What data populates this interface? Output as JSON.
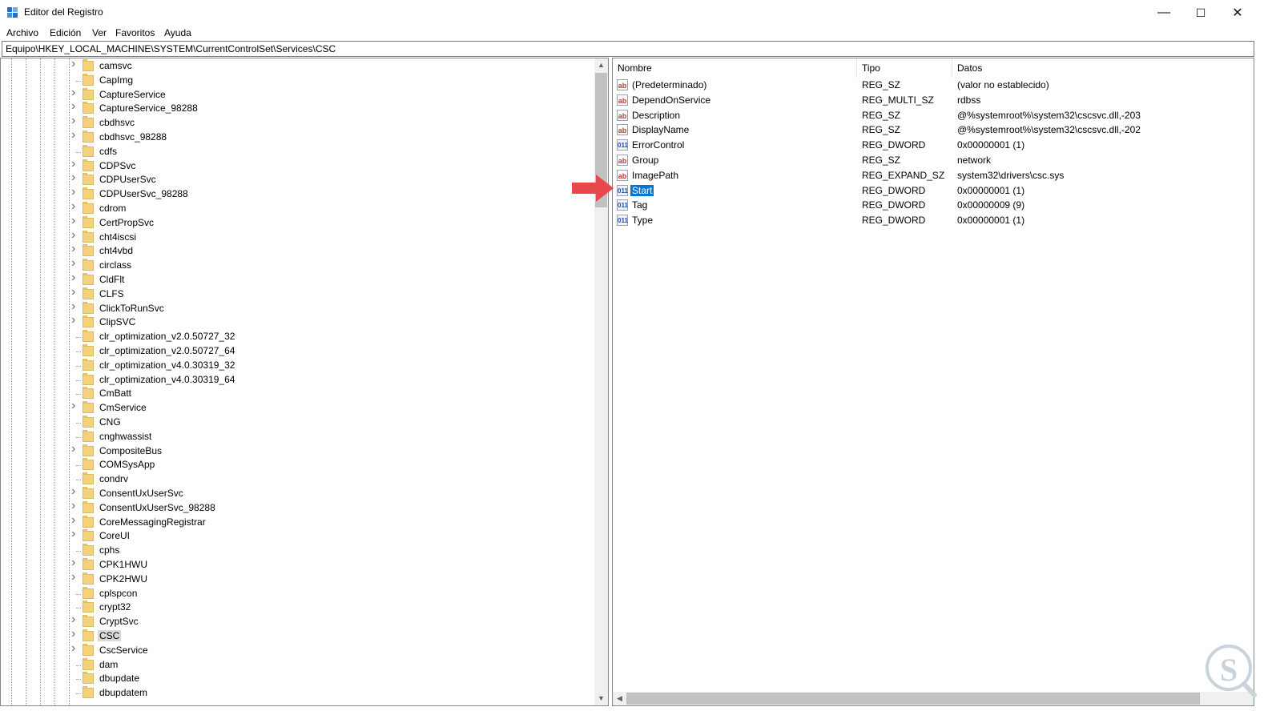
{
  "window": {
    "title": "Editor del Registro",
    "minimize_glyph": "—",
    "maximize_glyph": "☐",
    "close_glyph": "✕"
  },
  "menu": [
    "Archivo",
    "Edición",
    "Ver",
    "Favoritos",
    "Ayuda"
  ],
  "address": "Equipo\\HKEY_LOCAL_MACHINE\\SYSTEM\\CurrentControlSet\\Services\\CSC",
  "tree": {
    "items": [
      {
        "label": "camsvc",
        "expandable": true
      },
      {
        "label": "CapImg",
        "expandable": false
      },
      {
        "label": "CaptureService",
        "expandable": true
      },
      {
        "label": "CaptureService_98288",
        "expandable": true
      },
      {
        "label": "cbdhsvc",
        "expandable": true
      },
      {
        "label": "cbdhsvc_98288",
        "expandable": true
      },
      {
        "label": "cdfs",
        "expandable": false
      },
      {
        "label": "CDPSvc",
        "expandable": true
      },
      {
        "label": "CDPUserSvc",
        "expandable": true
      },
      {
        "label": "CDPUserSvc_98288",
        "expandable": true
      },
      {
        "label": "cdrom",
        "expandable": true
      },
      {
        "label": "CertPropSvc",
        "expandable": true
      },
      {
        "label": "cht4iscsi",
        "expandable": true
      },
      {
        "label": "cht4vbd",
        "expandable": true
      },
      {
        "label": "circlass",
        "expandable": true
      },
      {
        "label": "CldFlt",
        "expandable": true
      },
      {
        "label": "CLFS",
        "expandable": true
      },
      {
        "label": "ClickToRunSvc",
        "expandable": true
      },
      {
        "label": "ClipSVC",
        "expandable": true
      },
      {
        "label": "clr_optimization_v2.0.50727_32",
        "expandable": false
      },
      {
        "label": "clr_optimization_v2.0.50727_64",
        "expandable": false
      },
      {
        "label": "clr_optimization_v4.0.30319_32",
        "expandable": false
      },
      {
        "label": "clr_optimization_v4.0.30319_64",
        "expandable": false
      },
      {
        "label": "CmBatt",
        "expandable": false
      },
      {
        "label": "CmService",
        "expandable": true
      },
      {
        "label": "CNG",
        "expandable": false
      },
      {
        "label": "cnghwassist",
        "expandable": false
      },
      {
        "label": "CompositeBus",
        "expandable": true
      },
      {
        "label": "COMSysApp",
        "expandable": false
      },
      {
        "label": "condrv",
        "expandable": false
      },
      {
        "label": "ConsentUxUserSvc",
        "expandable": true
      },
      {
        "label": "ConsentUxUserSvc_98288",
        "expandable": true
      },
      {
        "label": "CoreMessagingRegistrar",
        "expandable": true
      },
      {
        "label": "CoreUI",
        "expandable": true
      },
      {
        "label": "cphs",
        "expandable": false
      },
      {
        "label": "CPK1HWU",
        "expandable": true
      },
      {
        "label": "CPK2HWU",
        "expandable": true
      },
      {
        "label": "cplspcon",
        "expandable": false
      },
      {
        "label": "crypt32",
        "expandable": false
      },
      {
        "label": "CryptSvc",
        "expandable": true
      },
      {
        "label": "CSC",
        "expandable": true,
        "selected": true
      },
      {
        "label": "CscService",
        "expandable": true
      },
      {
        "label": "dam",
        "expandable": false
      },
      {
        "label": "dbupdate",
        "expandable": false
      },
      {
        "label": "dbupdatem",
        "expandable": false
      }
    ]
  },
  "list": {
    "columns": [
      "Nombre",
      "Tipo",
      "Datos"
    ],
    "rows": [
      {
        "name": "(Predeterminado)",
        "type": "REG_SZ",
        "data": "(valor no establecido)",
        "icon": "string-value-icon"
      },
      {
        "name": "DependOnService",
        "type": "REG_MULTI_SZ",
        "data": "rdbss",
        "icon": "string-value-icon"
      },
      {
        "name": "Description",
        "type": "REG_SZ",
        "data": "@%systemroot%\\system32\\cscsvc.dll,-203",
        "icon": "string-value-icon"
      },
      {
        "name": "DisplayName",
        "type": "REG_SZ",
        "data": "@%systemroot%\\system32\\cscsvc.dll,-202",
        "icon": "string-value-icon"
      },
      {
        "name": "ErrorControl",
        "type": "REG_DWORD",
        "data": "0x00000001 (1)",
        "icon": "binary-value-icon"
      },
      {
        "name": "Group",
        "type": "REG_SZ",
        "data": "network",
        "icon": "string-value-icon"
      },
      {
        "name": "ImagePath",
        "type": "REG_EXPAND_SZ",
        "data": "system32\\drivers\\csc.sys",
        "icon": "string-value-icon"
      },
      {
        "name": "Start",
        "type": "REG_DWORD",
        "data": "0x00000001 (1)",
        "icon": "binary-value-icon",
        "selected": true
      },
      {
        "name": "Tag",
        "type": "REG_DWORD",
        "data": "0x00000009 (9)",
        "icon": "binary-value-icon"
      },
      {
        "name": "Type",
        "type": "REG_DWORD",
        "data": "0x00000001 (1)",
        "icon": "binary-value-icon"
      }
    ]
  },
  "colors": {
    "selection": "#0078d7",
    "arrow": "#e8474c",
    "folder": "#f2d27a"
  }
}
